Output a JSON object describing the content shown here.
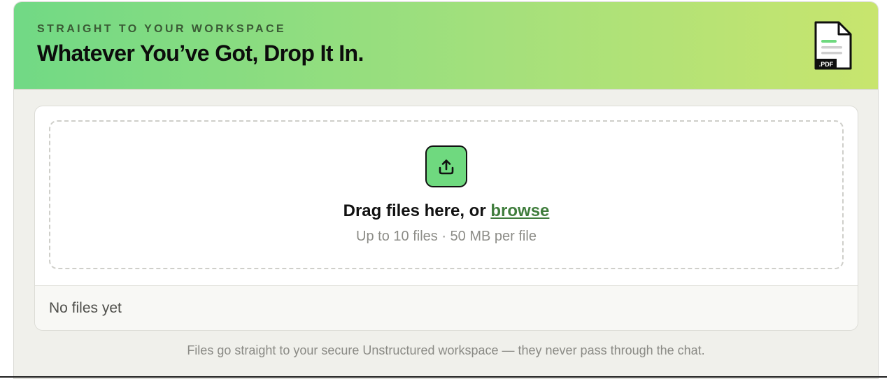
{
  "header": {
    "eyebrow": "STRAIGHT TO YOUR WORKSPACE",
    "title": "Whatever You’ve Got, Drop It In.",
    "pdf_icon_label": ".PDF",
    "icon": "pdf-file-icon"
  },
  "dropzone": {
    "upload_icon": "upload-icon",
    "drag_text": "Drag files here, or ",
    "browse_label": "browse",
    "limits_text": "Up to 10 files · 50 MB per file"
  },
  "files": {
    "empty_text": "No files yet"
  },
  "footer": {
    "note": "Files go straight to your secure Unstructured workspace — they never pass through the chat."
  },
  "colors": {
    "header_gradient_start": "#71d985",
    "header_gradient_end": "#c8e56e",
    "upload_button": "#6fd97f",
    "browse_link": "#3f7d3c",
    "card_background": "#f0f0eb"
  }
}
